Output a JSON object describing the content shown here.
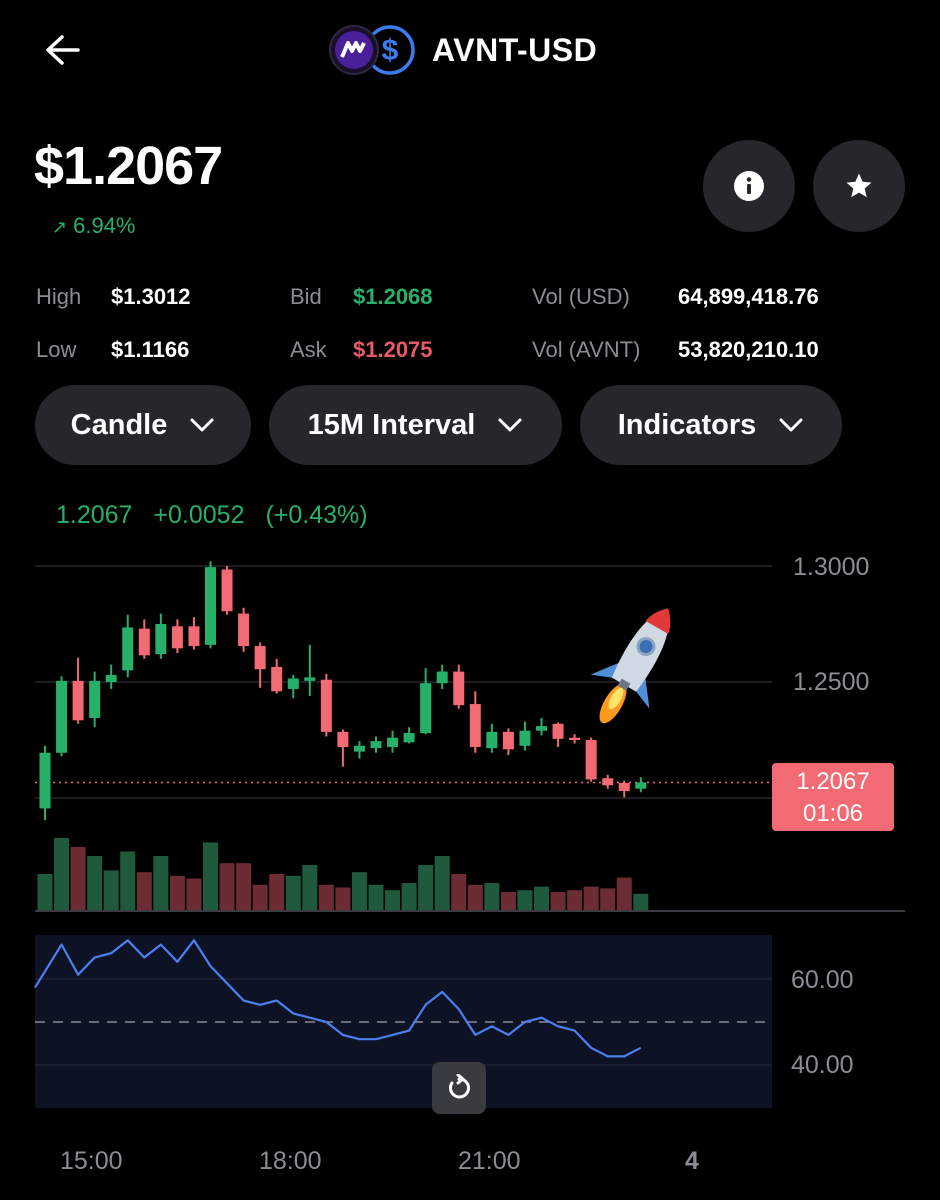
{
  "header": {
    "title": "AVNT-USD",
    "back_icon": "arrow-left-icon",
    "base_icon": "avnt-token-icon",
    "quote_icon": "usd-dollar-icon"
  },
  "price": {
    "value": "$1.2067",
    "change": "6.94%",
    "change_icon": "arrow-up-right-icon"
  },
  "buttons": {
    "info_icon": "info-icon",
    "star_icon": "star-icon"
  },
  "stats": {
    "high_label": "High",
    "high": "$1.3012",
    "low_label": "Low",
    "low": "$1.1166",
    "bid_label": "Bid",
    "bid": "$1.2068",
    "ask_label": "Ask",
    "ask": "$1.2075",
    "vol_usd_label": "Vol (USD)",
    "vol_usd": "64,899,418.76",
    "vol_avnt_label": "Vol (AVNT)",
    "vol_avnt": "53,820,210.10"
  },
  "controls": {
    "chart_type": "Candle",
    "interval": "15M Interval",
    "indicators": "Indicators"
  },
  "readout": {
    "last": "1.2067",
    "delta": "+0.0052",
    "delta_pct": "(+0.43%)"
  },
  "price_tag": {
    "price": "1.2067",
    "countdown": "01:06"
  },
  "colors": {
    "up": "#27b06a",
    "down": "#f26a73",
    "rsi_line": "#4c7ff0",
    "background": "#000000"
  },
  "chart_data": {
    "type": "candlestick",
    "price_axis": {
      "ticks": [
        "1.3000",
        "1.2500"
      ],
      "range": [
        1.19,
        1.305
      ]
    },
    "rsi_axis": {
      "ticks": [
        "60.00",
        "40.00"
      ],
      "range": [
        32,
        73
      ],
      "midline": 50
    },
    "x_ticks": [
      "15:00",
      "18:00",
      "21:00",
      "4"
    ],
    "candles": [
      [
        1.1955,
        1.2195,
        1.1905,
        1.2225
      ],
      [
        1.2195,
        1.2505,
        1.218,
        1.2525
      ],
      [
        1.2505,
        1.2335,
        1.232,
        1.2605
      ],
      [
        1.2345,
        1.2505,
        1.2305,
        1.2545
      ],
      [
        1.25,
        1.253,
        1.247,
        1.2575
      ],
      [
        1.255,
        1.2735,
        1.252,
        1.279
      ],
      [
        1.273,
        1.2615,
        1.26,
        1.277
      ],
      [
        1.262,
        1.275,
        1.26,
        1.2795
      ],
      [
        1.274,
        1.2645,
        1.2625,
        1.277
      ],
      [
        1.274,
        1.2655,
        1.264,
        1.278
      ],
      [
        1.266,
        1.2995,
        1.2645,
        1.302
      ],
      [
        1.2985,
        1.2805,
        1.279,
        1.3
      ],
      [
        1.2795,
        1.2655,
        1.263,
        1.282
      ],
      [
        1.2655,
        1.2555,
        1.2475,
        1.267
      ],
      [
        1.2565,
        1.246,
        1.245,
        1.26
      ],
      [
        1.247,
        1.2515,
        1.243,
        1.253
      ],
      [
        1.2505,
        1.252,
        1.244,
        1.266
      ],
      [
        1.251,
        1.2285,
        1.2265,
        1.2535
      ],
      [
        1.2285,
        1.222,
        1.2135,
        1.2295
      ],
      [
        1.22,
        1.2225,
        1.217,
        1.2245
      ],
      [
        1.2215,
        1.2245,
        1.2195,
        1.2265
      ],
      [
        1.222,
        1.226,
        1.2195,
        1.229
      ],
      [
        1.224,
        1.228,
        1.2235,
        1.2305
      ],
      [
        1.228,
        1.2495,
        1.2275,
        1.256
      ],
      [
        1.2495,
        1.2545,
        1.247,
        1.2575
      ],
      [
        1.2545,
        1.24,
        1.2385,
        1.2575
      ],
      [
        1.2405,
        1.222,
        1.2195,
        1.246
      ],
      [
        1.2215,
        1.2285,
        1.2195,
        1.232
      ],
      [
        1.2285,
        1.221,
        1.2185,
        1.23
      ],
      [
        1.2225,
        1.229,
        1.2205,
        1.233
      ],
      [
        1.229,
        1.231,
        1.227,
        1.2345
      ],
      [
        1.232,
        1.2255,
        1.222,
        1.2325
      ],
      [
        1.226,
        1.225,
        1.2235,
        1.2275
      ],
      [
        1.225,
        1.208,
        1.207,
        1.226
      ],
      [
        1.2085,
        1.2055,
        1.204,
        1.21
      ],
      [
        1.2065,
        1.203,
        1.2003,
        1.2075
      ],
      [
        1.204,
        1.2067,
        1.2025,
        1.209
      ]
    ],
    "volume": [
      40,
      80,
      70,
      60,
      44,
      65,
      42,
      60,
      38,
      35,
      75,
      52,
      52,
      28,
      40,
      38,
      50,
      28,
      25,
      42,
      28,
      22,
      30,
      50,
      60,
      40,
      28,
      30,
      20,
      22,
      26,
      20,
      22,
      26,
      24,
      36,
      18
    ],
    "rsi": [
      58,
      68,
      61,
      65,
      66,
      69,
      65,
      68,
      64,
      69,
      63,
      59,
      55,
      54,
      55,
      52,
      51,
      50,
      47,
      46,
      46,
      47,
      48,
      54,
      57,
      53,
      47,
      49,
      47,
      50,
      51,
      49,
      48,
      44,
      42,
      42,
      44
    ]
  }
}
